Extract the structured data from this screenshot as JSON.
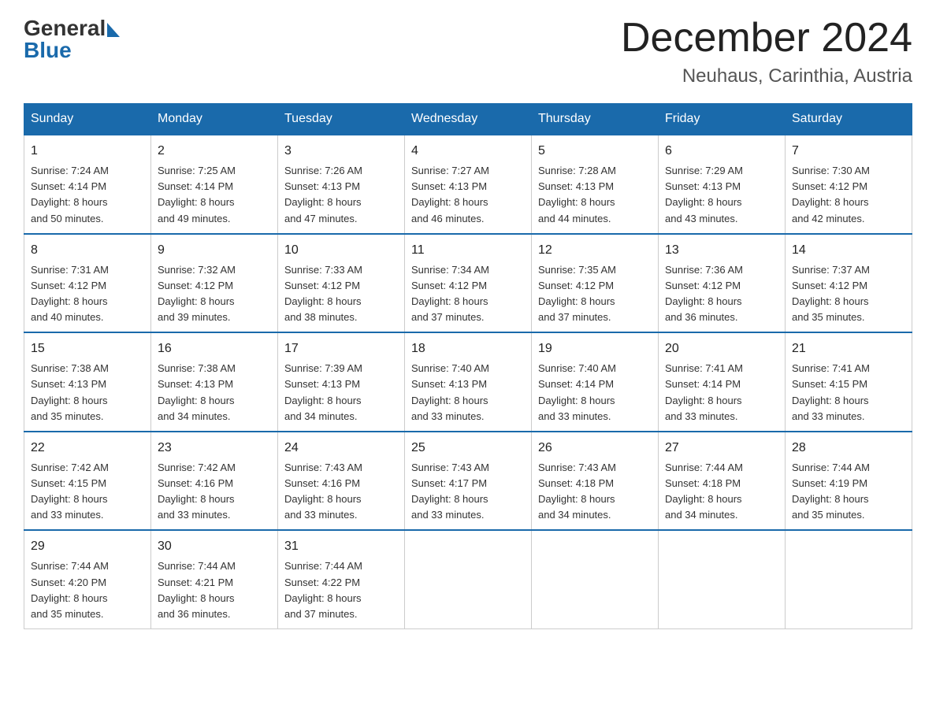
{
  "logo": {
    "general": "General",
    "blue": "Blue"
  },
  "title": "December 2024",
  "location": "Neuhaus, Carinthia, Austria",
  "weekdays": [
    "Sunday",
    "Monday",
    "Tuesday",
    "Wednesday",
    "Thursday",
    "Friday",
    "Saturday"
  ],
  "weeks": [
    [
      {
        "day": "1",
        "sunrise": "7:24 AM",
        "sunset": "4:14 PM",
        "daylight": "8 hours and 50 minutes."
      },
      {
        "day": "2",
        "sunrise": "7:25 AM",
        "sunset": "4:14 PM",
        "daylight": "8 hours and 49 minutes."
      },
      {
        "day": "3",
        "sunrise": "7:26 AM",
        "sunset": "4:13 PM",
        "daylight": "8 hours and 47 minutes."
      },
      {
        "day": "4",
        "sunrise": "7:27 AM",
        "sunset": "4:13 PM",
        "daylight": "8 hours and 46 minutes."
      },
      {
        "day": "5",
        "sunrise": "7:28 AM",
        "sunset": "4:13 PM",
        "daylight": "8 hours and 44 minutes."
      },
      {
        "day": "6",
        "sunrise": "7:29 AM",
        "sunset": "4:13 PM",
        "daylight": "8 hours and 43 minutes."
      },
      {
        "day": "7",
        "sunrise": "7:30 AM",
        "sunset": "4:12 PM",
        "daylight": "8 hours and 42 minutes."
      }
    ],
    [
      {
        "day": "8",
        "sunrise": "7:31 AM",
        "sunset": "4:12 PM",
        "daylight": "8 hours and 40 minutes."
      },
      {
        "day": "9",
        "sunrise": "7:32 AM",
        "sunset": "4:12 PM",
        "daylight": "8 hours and 39 minutes."
      },
      {
        "day": "10",
        "sunrise": "7:33 AM",
        "sunset": "4:12 PM",
        "daylight": "8 hours and 38 minutes."
      },
      {
        "day": "11",
        "sunrise": "7:34 AM",
        "sunset": "4:12 PM",
        "daylight": "8 hours and 37 minutes."
      },
      {
        "day": "12",
        "sunrise": "7:35 AM",
        "sunset": "4:12 PM",
        "daylight": "8 hours and 37 minutes."
      },
      {
        "day": "13",
        "sunrise": "7:36 AM",
        "sunset": "4:12 PM",
        "daylight": "8 hours and 36 minutes."
      },
      {
        "day": "14",
        "sunrise": "7:37 AM",
        "sunset": "4:12 PM",
        "daylight": "8 hours and 35 minutes."
      }
    ],
    [
      {
        "day": "15",
        "sunrise": "7:38 AM",
        "sunset": "4:13 PM",
        "daylight": "8 hours and 35 minutes."
      },
      {
        "day": "16",
        "sunrise": "7:38 AM",
        "sunset": "4:13 PM",
        "daylight": "8 hours and 34 minutes."
      },
      {
        "day": "17",
        "sunrise": "7:39 AM",
        "sunset": "4:13 PM",
        "daylight": "8 hours and 34 minutes."
      },
      {
        "day": "18",
        "sunrise": "7:40 AM",
        "sunset": "4:13 PM",
        "daylight": "8 hours and 33 minutes."
      },
      {
        "day": "19",
        "sunrise": "7:40 AM",
        "sunset": "4:14 PM",
        "daylight": "8 hours and 33 minutes."
      },
      {
        "day": "20",
        "sunrise": "7:41 AM",
        "sunset": "4:14 PM",
        "daylight": "8 hours and 33 minutes."
      },
      {
        "day": "21",
        "sunrise": "7:41 AM",
        "sunset": "4:15 PM",
        "daylight": "8 hours and 33 minutes."
      }
    ],
    [
      {
        "day": "22",
        "sunrise": "7:42 AM",
        "sunset": "4:15 PM",
        "daylight": "8 hours and 33 minutes."
      },
      {
        "day": "23",
        "sunrise": "7:42 AM",
        "sunset": "4:16 PM",
        "daylight": "8 hours and 33 minutes."
      },
      {
        "day": "24",
        "sunrise": "7:43 AM",
        "sunset": "4:16 PM",
        "daylight": "8 hours and 33 minutes."
      },
      {
        "day": "25",
        "sunrise": "7:43 AM",
        "sunset": "4:17 PM",
        "daylight": "8 hours and 33 minutes."
      },
      {
        "day": "26",
        "sunrise": "7:43 AM",
        "sunset": "4:18 PM",
        "daylight": "8 hours and 34 minutes."
      },
      {
        "day": "27",
        "sunrise": "7:44 AM",
        "sunset": "4:18 PM",
        "daylight": "8 hours and 34 minutes."
      },
      {
        "day": "28",
        "sunrise": "7:44 AM",
        "sunset": "4:19 PM",
        "daylight": "8 hours and 35 minutes."
      }
    ],
    [
      {
        "day": "29",
        "sunrise": "7:44 AM",
        "sunset": "4:20 PM",
        "daylight": "8 hours and 35 minutes."
      },
      {
        "day": "30",
        "sunrise": "7:44 AM",
        "sunset": "4:21 PM",
        "daylight": "8 hours and 36 minutes."
      },
      {
        "day": "31",
        "sunrise": "7:44 AM",
        "sunset": "4:22 PM",
        "daylight": "8 hours and 37 minutes."
      },
      null,
      null,
      null,
      null
    ]
  ],
  "labels": {
    "sunrise": "Sunrise:",
    "sunset": "Sunset:",
    "daylight": "Daylight:"
  }
}
